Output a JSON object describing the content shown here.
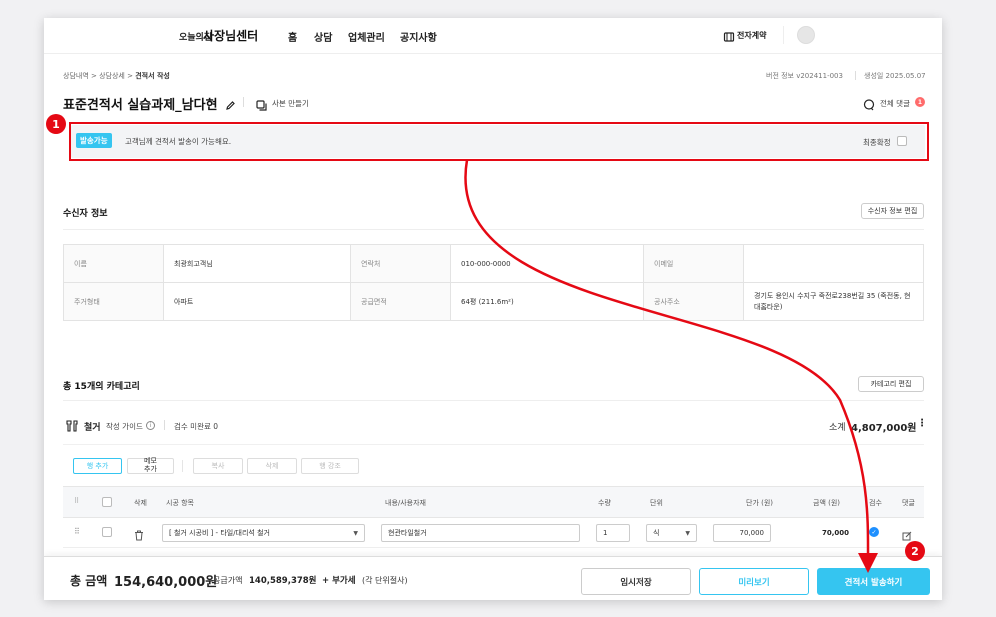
{
  "header": {
    "brand_small": "오늘의집",
    "brand_big": "사장님센터",
    "nav": [
      "홈",
      "상담",
      "업체관리",
      "공지사항"
    ],
    "contract_label": "전자계약"
  },
  "breadcrumb": {
    "items": [
      "상담내역",
      "상담상세"
    ],
    "current": "견적서 작성"
  },
  "version_info": "버전 정보 v202411-003",
  "created_date": "생성일 2025.05.07",
  "page_title": "표준견적서 실습과제_남다현",
  "copy_label": "사본 만들기",
  "comments_label": "전체 댓글",
  "comments_count": "1",
  "notice": {
    "badge": "발송가능",
    "text": "고객님께 견적서 발송이 가능해요.",
    "final_label": "최종확정"
  },
  "recipient": {
    "section_title": "수신자 정보",
    "edit_button": "수신자 정보 편집",
    "rows": [
      [
        {
          "label": "이름",
          "value": "최광희고객님"
        },
        {
          "label": "연락처",
          "value": "010-000-0000"
        },
        {
          "label": "이메일",
          "value": ""
        }
      ],
      [
        {
          "label": "주거형태",
          "value": "아파트"
        },
        {
          "label": "공급면적",
          "value": "64평 (211.6m²)"
        },
        {
          "label": "공사주소",
          "value": "경기도 용인시 수지구 죽전로238번길 35 (죽전동, 현대홈타운)"
        }
      ]
    ]
  },
  "categories": {
    "title": "총 15개의 카테고리",
    "edit_button": "카테고리 편집",
    "current": {
      "name": "철거",
      "guide": "작성 가이드",
      "inspection": "검수 미완료 0",
      "subtotal_label": "소계",
      "subtotal_value": "4,807,000원"
    },
    "toolbar": [
      "행 추가",
      "메모 추가",
      "복사",
      "삭제",
      "행 강조"
    ],
    "columns": [
      "삭제",
      "시공 항목",
      "내용/사용자재",
      "수량",
      "단위",
      "단가 (원)",
      "금액 (원)",
      "검수",
      "댓글"
    ],
    "row": {
      "item": "[ 철거 시공비 ] - 타일/대리석 철거",
      "content": "현관타일철거",
      "qty": "1",
      "unit": "식",
      "unit_price": "70,000",
      "amount": "70,000"
    }
  },
  "footer": {
    "total_label": "총 금액",
    "total_value": "154,640,000원",
    "supply_label": "공급가액",
    "supply_value": "140,589,378원",
    "vat_text": "+ 부가세",
    "vat_note": "(각 단위절사)",
    "save_button": "임시저장",
    "preview_button": "미리보기",
    "send_button": "견적서 발송하기"
  },
  "markers": [
    "1",
    "2"
  ],
  "colors": {
    "accent": "#35c5f0",
    "annotation": "#e50914"
  }
}
